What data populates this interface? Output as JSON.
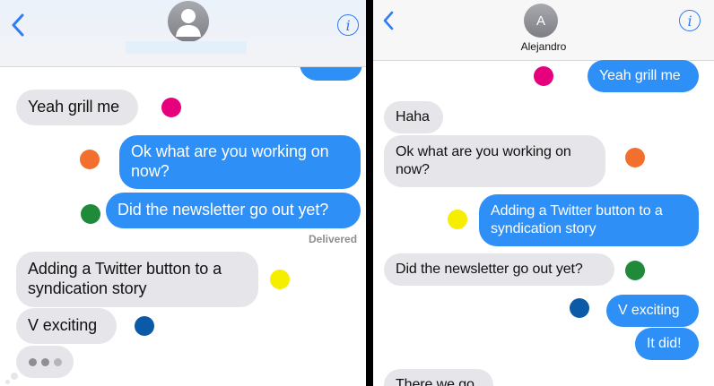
{
  "left": {
    "header": {
      "back_icon": "chevron-left-icon",
      "info_icon": "info-circle-icon",
      "avatar_icon": "person-silhouette-icon"
    },
    "messages": [
      {
        "text": "",
        "dir": "out"
      },
      {
        "text": "Yeah grill me",
        "dir": "in"
      },
      {
        "text": "Ok what are you working on now?",
        "dir": "out"
      },
      {
        "text": "Did the newsletter go out yet?",
        "dir": "out"
      },
      {
        "text": "Adding a Twitter button to a syndication story",
        "dir": "in"
      },
      {
        "text": "V exciting",
        "dir": "in"
      }
    ],
    "status": "Delivered",
    "typing_indicator": "typing-dots-icon"
  },
  "right": {
    "header": {
      "back_icon": "chevron-left-icon",
      "info_icon": "info-circle-icon",
      "avatar_initial": "A",
      "contact_name": "Alejandro"
    },
    "messages": [
      {
        "text": "Yeah grill me",
        "dir": "out"
      },
      {
        "text": "Haha",
        "dir": "in"
      },
      {
        "text": "Ok what are you working on now?",
        "dir": "in"
      },
      {
        "text": "Adding a Twitter button to a syndication story",
        "dir": "out"
      },
      {
        "text": "Did the newsletter go out yet?",
        "dir": "in"
      },
      {
        "text": "V exciting",
        "dir": "out"
      },
      {
        "text": "It did!",
        "dir": "out"
      },
      {
        "text": "There we go",
        "dir": "in"
      }
    ]
  },
  "colors": {
    "outgoing_bubble": "#2e8ff6",
    "incoming_bubble": "#e6e6ea",
    "ios_blue": "#2f7cf6",
    "marker_magenta": "#e6007e",
    "marker_orange": "#f26f2d",
    "marker_green": "#1f8a3a",
    "marker_yellow": "#f5ee00",
    "marker_blue": "#0b5aa8"
  }
}
